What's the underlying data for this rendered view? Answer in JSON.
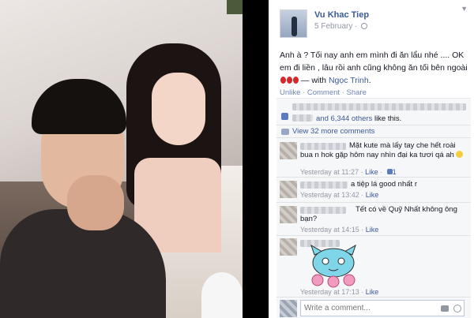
{
  "post": {
    "author": "Vu Khac Tiep",
    "time": "5 February",
    "text_before": "Anh à ? Tối nay anh em mình đi ăn lẩu nhé .... OK em đi liền , lâu rồi anh cũng không ăn tối bên ngoài",
    "text_with": "— with",
    "tagged": "Ngọc Trinh",
    "actions": [
      "Unlike",
      "Comment",
      "Share"
    ]
  },
  "likes": {
    "link": "and 6,344 others",
    "suffix": "like this."
  },
  "view_more": "View 32 more comments",
  "comments": [
    {
      "text": "Mặt kute mà lấy tay che hết roài bua n hok gặp hôm nay nhìn đại ka tươi qá ah",
      "time": "Yesterday at 11:27",
      "like": "Like",
      "likes": "1"
    },
    {
      "text": "a tiệp lá good nhất r",
      "time": "Yesterday at 13:42",
      "like": "Like"
    },
    {
      "text": "Tết có về Quỹ Nhất không ông bạn?",
      "time": "Yesterday at 14:15",
      "like": "Like"
    },
    {
      "text": "",
      "time": "Yesterday at 17:13",
      "like": "Like"
    }
  ],
  "composer": {
    "placeholder": "Write a comment..."
  },
  "icons": {
    "globe": "globe-icon",
    "camera": "camera-icon",
    "emoticon": "smile-icon"
  },
  "colors": {
    "link": "#3b5998",
    "meta": "#9197a3",
    "panel_bg": "#f6f7f9"
  }
}
